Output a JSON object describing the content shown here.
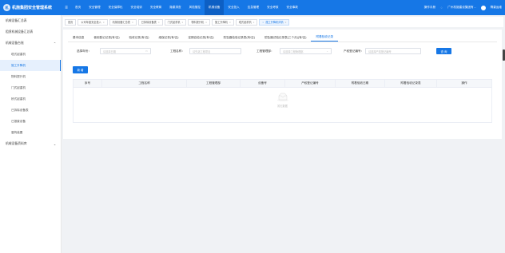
{
  "app": {
    "logo_text": "机",
    "title": "机施集团安全管理系统",
    "menu_icon": "menu-icon"
  },
  "nav": {
    "items": [
      {
        "label": "首页"
      },
      {
        "label": "安全管理"
      },
      {
        "label": "安全保障化"
      },
      {
        "label": "安全培训"
      },
      {
        "label": "安全教育"
      },
      {
        "label": "隐患排查"
      },
      {
        "label": "风险管控"
      },
      {
        "label": "机械设备",
        "active": true
      },
      {
        "label": "安全投入"
      },
      {
        "label": "应急管理"
      },
      {
        "label": "安全考核"
      },
      {
        "label": "安全事故"
      }
    ],
    "right": {
      "manual": "操作手册",
      "org": "广州机施建设集团有...",
      "user": "隋豪运维"
    }
  },
  "sidebar": {
    "items": [
      {
        "label": "机械设备汇总表",
        "type": "item"
      },
      {
        "label": "租赁机械设备汇总表",
        "type": "item"
      },
      {
        "label": "机械设备台账",
        "type": "group",
        "expanded": true
      },
      {
        "label": "塔式起重机",
        "type": "sub"
      },
      {
        "label": "施工升降机",
        "type": "sub",
        "active": true
      },
      {
        "label": "物料提升机",
        "type": "sub"
      },
      {
        "label": "门式起重机",
        "type": "sub"
      },
      {
        "label": "桥式起重机",
        "type": "sub"
      },
      {
        "label": "已拆除设备表",
        "type": "sub"
      },
      {
        "label": "已报废设备",
        "type": "sub"
      },
      {
        "label": "盾构装置",
        "type": "sub"
      },
      {
        "label": "机械设备资料库",
        "type": "group",
        "expanded": false
      }
    ]
  },
  "page_tabs": [
    {
      "label": "首页",
      "closable": false
    },
    {
      "label": "公司年度安全投入",
      "closable": true
    },
    {
      "label": "机械设备汇总表",
      "closable": true
    },
    {
      "label": "已拆除设备表",
      "closable": true
    },
    {
      "label": "门式起重机",
      "closable": true
    },
    {
      "label": "物料提升机",
      "closable": true
    },
    {
      "label": "施工升降机",
      "closable": true
    },
    {
      "label": "塔式起重机",
      "closable": true
    },
    {
      "label": "施工升降机详情",
      "closable": true,
      "active": true
    }
  ],
  "sub_tabs": [
    {
      "label": "基本信息"
    },
    {
      "label": "使用登记记录(有/否)"
    },
    {
      "label": "验收记录(有/否)"
    },
    {
      "label": "维保记录(有/否)"
    },
    {
      "label": "定期自检记录(有/否)"
    },
    {
      "label": "防坠器检验记录表(有/否)"
    },
    {
      "label": "防坠器试验记录表(三个月)(有/否)"
    },
    {
      "label": "附着验收记录",
      "active": true
    }
  ],
  "filters": {
    "date_label": "选择年份：",
    "date_placeholder": "请选择日期",
    "project_label": "工程名称：",
    "project_placeholder": "请先选工程项目",
    "manager_label": "工程管理部：",
    "manager_placeholder": "请选择工程管理部",
    "prop_label": "产权登记编号：",
    "prop_placeholder": "请选择产权登记编号",
    "query_btn": "查 询"
  },
  "add_btn": "新 增",
  "table": {
    "columns": [
      "序号",
      "工程名称",
      "工程管理部",
      "设备号",
      "产权登记编号",
      "附着验收日期",
      "附着验收记录表",
      "操作"
    ],
    "empty_text": "暂无数据"
  },
  "colors": {
    "primary": "#1677e6",
    "nav_active": "#0d5fc4"
  }
}
